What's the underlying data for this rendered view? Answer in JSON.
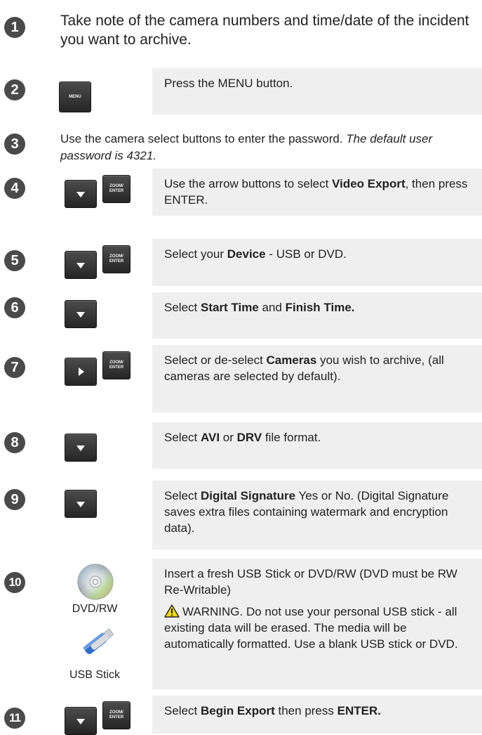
{
  "steps": {
    "s1": {
      "number": "1",
      "text": "Take note of the camera numbers and time/date of the incident you want to archive."
    },
    "s2": {
      "number": "2",
      "text": "Press the MENU button.",
      "button": "MENU"
    },
    "s3": {
      "number": "3",
      "text_plain": "Use the camera select buttons to enter the password. ",
      "text_italic": "The default user password is 4321."
    },
    "s4": {
      "number": "4",
      "pre": "Use the arrow buttons to select ",
      "bold": "Video Export",
      "post": ", then press ENTER."
    },
    "s5": {
      "number": "5",
      "pre": "Select your ",
      "bold": "Device",
      "post": " - USB or DVD."
    },
    "s6": {
      "number": "6",
      "pre": "Select ",
      "bold1": "Start Time",
      "mid": " and ",
      "bold2": "Finish Time."
    },
    "s7": {
      "number": "7",
      "pre": "Select or de-select ",
      "bold": "Cameras",
      "post": " you wish to archive, (all cameras are selected by default)."
    },
    "s8": {
      "number": "8",
      "pre": "Select ",
      "bold1": "AVI",
      "mid": " or ",
      "bold2": "DRV",
      "post": " file format."
    },
    "s9": {
      "number": "9",
      "pre": "Select ",
      "bold": "Digital Signature",
      "post": " Yes or No. (Digital Signature saves extra files containing watermark and encryption data)."
    },
    "s10": {
      "number": "10",
      "text": "Insert a fresh USB Stick or DVD/RW (DVD must be RW Re-Writable)",
      "warning": "WARNING. Do not use your personal USB stick - all existing data will be erased. The media will be automatically formatted. Use a blank USB stick or DVD.",
      "dvd_caption": "DVD/RW",
      "usb_caption": "USB Stick"
    },
    "s11": {
      "number": "11",
      "pre": "Select ",
      "bold1": "Begin Export",
      "mid": " then press ",
      "bold2": "ENTER."
    }
  },
  "buttons": {
    "zoom_line1": "ZOOM/",
    "zoom_line2": "ENTER"
  },
  "icons": {
    "down": "down-arrow-icon",
    "right": "play-arrow-icon",
    "warning": "warning-icon",
    "dvd": "dvd-icon",
    "usb": "usb-stick-icon"
  },
  "colors": {
    "step_circle": "#4a4a4a",
    "box_bg": "#efefef",
    "warning_yellow": "#f5d90a"
  }
}
